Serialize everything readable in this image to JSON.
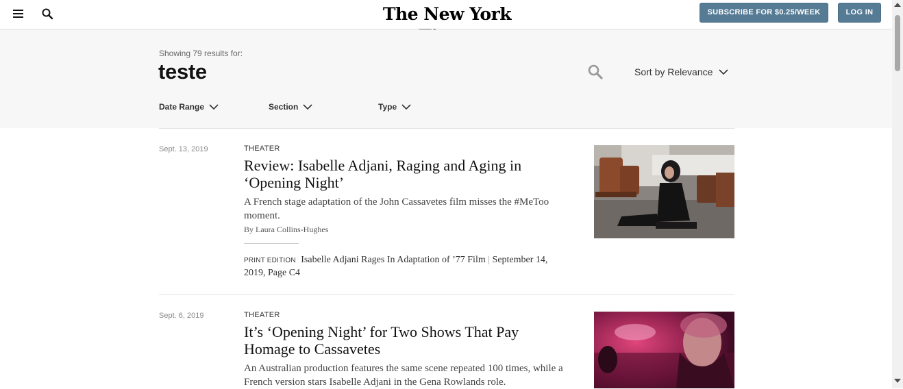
{
  "header": {
    "logo": "The New York Times",
    "subscribe_label": "SUBSCRIBE FOR $0.25/WEEK",
    "login_label": "LOG IN",
    "menu_icon": "hamburger-menu-icon",
    "search_icon": "search-icon",
    "accent_color": "#567b95"
  },
  "search": {
    "showing_text": "Showing 79 results for:",
    "query": "teste",
    "sort_label": "Sort by Relevance",
    "filters": [
      "Date Range",
      "Section",
      "Type"
    ]
  },
  "results": [
    {
      "date": "Sept. 13, 2019",
      "section": "THEATER",
      "headline": "Review: Isabelle Adjani, Raging and Aging in ‘Opening Night’",
      "summary": "A French stage adaptation of the John Cassavetes film misses the #MeToo moment.",
      "byline": "By Laura Collins-Hughes",
      "print_tag": "PRINT EDITION",
      "print_title": "Isabelle Adjani Rages In Adaptation of ’77 Film",
      "print_sep": "|",
      "print_detail": "September 14, 2019, Page C4"
    },
    {
      "date": "Sept. 6, 2019",
      "section": "THEATER",
      "headline": "It’s ‘Opening Night’ for Two Shows That Pay Homage to Cassavetes",
      "summary": "An Australian production features the same scene repeated 100 times, while a French version stars Isabelle Adjani in the Gena Rowlands role."
    }
  ]
}
